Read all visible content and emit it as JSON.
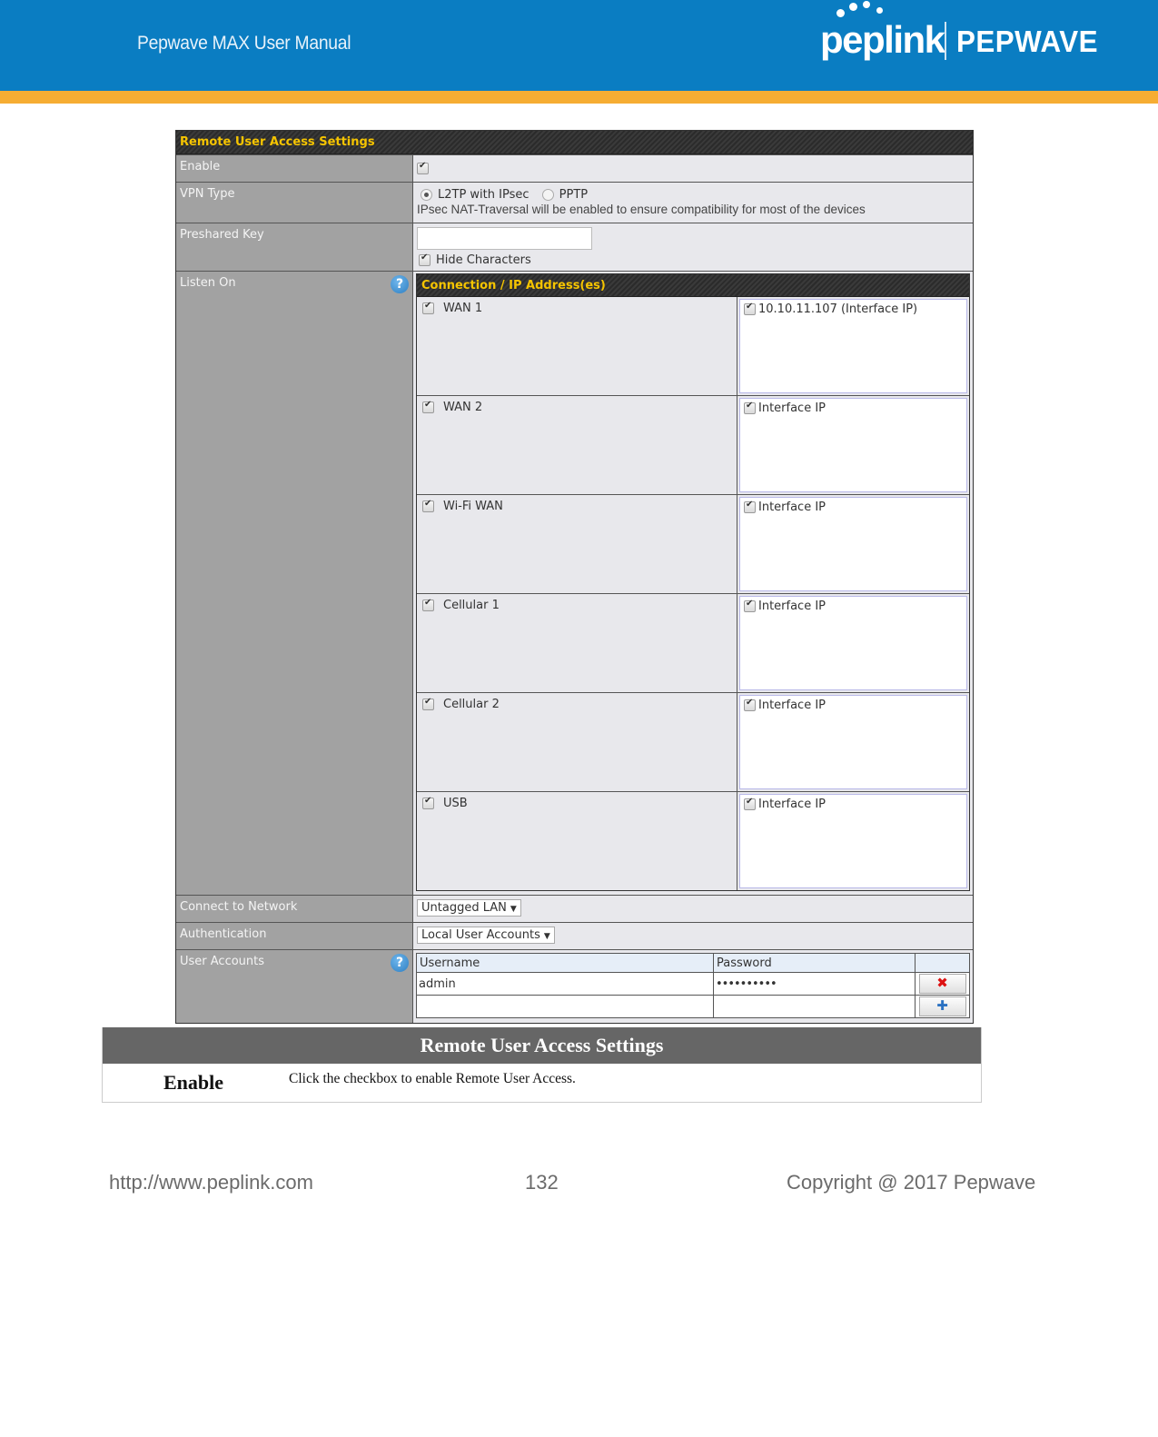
{
  "header": {
    "manual_title": "Pepwave MAX User Manual",
    "logo_left": "peplink",
    "logo_right": "PEPWAVE",
    "colors": {
      "band": "#0a7dc2",
      "stripe": "#f6ad33"
    }
  },
  "panel": {
    "title": "Remote User Access Settings",
    "enable": {
      "label": "Enable",
      "checked": true
    },
    "vpn_type": {
      "label": "VPN Type",
      "options": [
        {
          "label": "L2TP with IPsec",
          "selected": true
        },
        {
          "label": "PPTP",
          "selected": false
        }
      ],
      "note": "IPsec NAT-Traversal will be enabled to ensure compatibility for most of the devices"
    },
    "preshared_key": {
      "label": "Preshared Key",
      "value": "",
      "hide_characters_label": "Hide Characters",
      "hide_characters_checked": true
    },
    "listen_on": {
      "label": "Listen On",
      "help_icon": "?",
      "table_title": "Connection / IP Address(es)",
      "connections": [
        {
          "name": "WAN 1",
          "checked": true,
          "ip": "10.10.11.107 (Interface IP)",
          "ip_checked": true
        },
        {
          "name": "WAN 2",
          "checked": true,
          "ip": "Interface IP",
          "ip_checked": true
        },
        {
          "name": "Wi-Fi WAN",
          "checked": true,
          "ip": "Interface IP",
          "ip_checked": true
        },
        {
          "name": "Cellular 1",
          "checked": true,
          "ip": "Interface IP",
          "ip_checked": true
        },
        {
          "name": "Cellular 2",
          "checked": true,
          "ip": "Interface IP",
          "ip_checked": true
        },
        {
          "name": "USB",
          "checked": true,
          "ip": "Interface IP",
          "ip_checked": true
        }
      ]
    },
    "connect_to_network": {
      "label": "Connect to Network",
      "value": "Untagged LAN"
    },
    "authentication": {
      "label": "Authentication",
      "value": "Local User Accounts"
    },
    "user_accounts": {
      "label": "User Accounts",
      "help_icon": "?",
      "columns": [
        "Username",
        "Password"
      ],
      "rows": [
        {
          "username": "admin",
          "password": "••••••••••",
          "action_icon": "✖"
        }
      ],
      "add_icon": "✚"
    }
  },
  "description": {
    "title": "Remote User Access Settings",
    "rows": [
      {
        "key": "Enable",
        "text": "Click the checkbox to enable Remote User Access."
      }
    ]
  },
  "footer": {
    "url": "http://www.peplink.com",
    "page_number": "132",
    "copyright": "Copyright @ 2017 Pepwave"
  }
}
